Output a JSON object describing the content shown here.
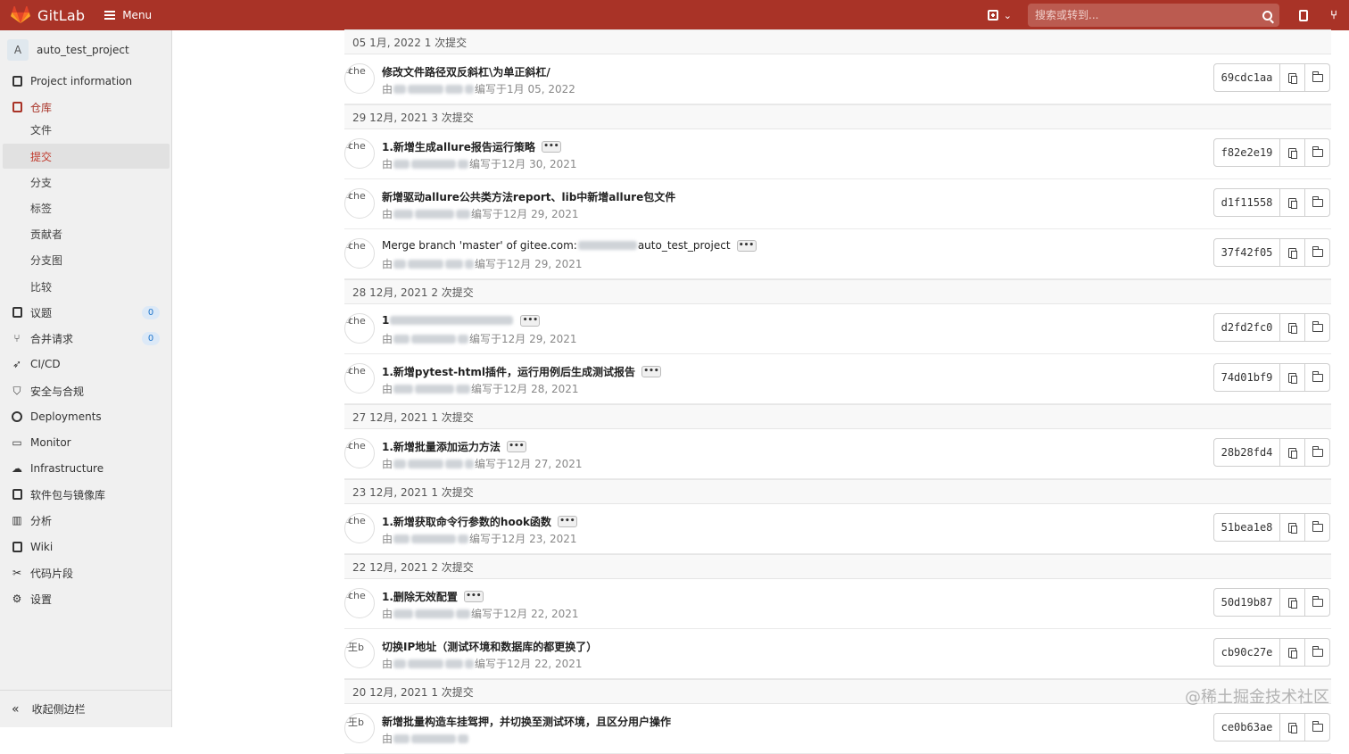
{
  "header": {
    "brand": "GitLab",
    "menu_label": "Menu",
    "search_placeholder": "搜索或转到..."
  },
  "sidebar": {
    "project_avatar_letter": "A",
    "project_name": "auto_test_project",
    "items": [
      {
        "label": "Project information",
        "icon": "project-info-icon"
      },
      {
        "label": "仓库",
        "icon": "repository-icon"
      },
      {
        "label": "议题",
        "icon": "issues-icon",
        "badge": "0"
      },
      {
        "label": "合并请求",
        "icon": "merge-request-icon",
        "badge": "0"
      },
      {
        "label": "CI/CD",
        "icon": "rocket-icon"
      },
      {
        "label": "安全与合规",
        "icon": "shield-icon"
      },
      {
        "label": "Deployments",
        "icon": "deployments-icon"
      },
      {
        "label": "Monitor",
        "icon": "monitor-icon"
      },
      {
        "label": "Infrastructure",
        "icon": "cloud-icon"
      },
      {
        "label": "软件包与镜像库",
        "icon": "package-icon"
      },
      {
        "label": "分析",
        "icon": "chart-icon"
      },
      {
        "label": "Wiki",
        "icon": "book-icon"
      },
      {
        "label": "代码片段",
        "icon": "snippet-icon"
      },
      {
        "label": "设置",
        "icon": "gear-icon"
      }
    ],
    "repo_sub": [
      "文件",
      "提交",
      "分支",
      "标签",
      "贡献者",
      "分支图",
      "比较"
    ],
    "collapse_label": "收起侧边栏"
  },
  "commit_groups": [
    {
      "header": "05 1月, 2022 1 次提交",
      "commits": [
        {
          "avatar_alt": "che",
          "title": "修改文件路径双反斜杠\\为单正斜杠/",
          "has_more": false,
          "authored": "编写于1月 05, 2022",
          "sha": "69cdc1aa"
        }
      ]
    },
    {
      "header": "29 12月, 2021 3 次提交",
      "commits": [
        {
          "avatar_alt": "che",
          "title": "1.新增生成allure报告运行策略",
          "has_more": true,
          "authored": "编写于12月 30, 2021",
          "sha": "f82e2e19"
        },
        {
          "avatar_alt": "che",
          "title": "新增驱动allure公共类方法report、lib中新增allure包文件",
          "has_more": false,
          "authored": "编写于12月 29, 2021",
          "sha": "d1f11558"
        },
        {
          "avatar_alt": "che",
          "title": "Merge branch 'master' of gitee.com:",
          "title_suffix": "auto_test_project",
          "has_more": true,
          "normal": true,
          "authored": "编写于12月 29, 2021",
          "sha": "37f42f05"
        }
      ]
    },
    {
      "header": "28 12月, 2021 2 次提交",
      "commits": [
        {
          "avatar_alt": "che",
          "title": "1",
          "has_more": true,
          "blurred_title": true,
          "authored": "编写于12月 29, 2021",
          "sha": "d2fd2fc0"
        },
        {
          "avatar_alt": "che",
          "title": "1.新增pytest-html插件，运行用例后生成测试报告",
          "has_more": true,
          "authored": "编写于12月 28, 2021",
          "sha": "74d01bf9"
        }
      ]
    },
    {
      "header": "27 12月, 2021 1 次提交",
      "commits": [
        {
          "avatar_alt": "che",
          "title": "1.新增批量添加运力方法",
          "has_more": true,
          "authored": "编写于12月 27, 2021",
          "sha": "28b28fd4"
        }
      ]
    },
    {
      "header": "23 12月, 2021 1 次提交",
      "commits": [
        {
          "avatar_alt": "che",
          "title": "1.新增获取命令行参数的hook函数",
          "has_more": true,
          "authored": "编写于12月 23, 2021",
          "sha": "51bea1e8"
        }
      ]
    },
    {
      "header": "22 12月, 2021 2 次提交",
      "commits": [
        {
          "avatar_alt": "che",
          "title": "1.删除无效配置",
          "has_more": true,
          "authored": "编写于12月 22, 2021",
          "sha": "50d19b87"
        },
        {
          "avatar_alt": "王b",
          "title": "切换IP地址（测试环境和数据库的都更换了）",
          "has_more": false,
          "authored": "编写于12月 22, 2021",
          "sha": "cb90c27e"
        }
      ]
    },
    {
      "header": "20 12月, 2021 1 次提交",
      "commits": [
        {
          "avatar_alt": "王b",
          "title": "新增批量构造车挂驾押，并切换至测试环境，且区分用户操作",
          "has_more": false,
          "authored": "",
          "sha": "ce0b63ae"
        }
      ]
    }
  ],
  "author_prefix": "由",
  "watermark": "@稀土掘金技术社区",
  "colors": {
    "header": "#a93327",
    "active_nav": "#c0392b",
    "badge": "#1f75cb"
  }
}
